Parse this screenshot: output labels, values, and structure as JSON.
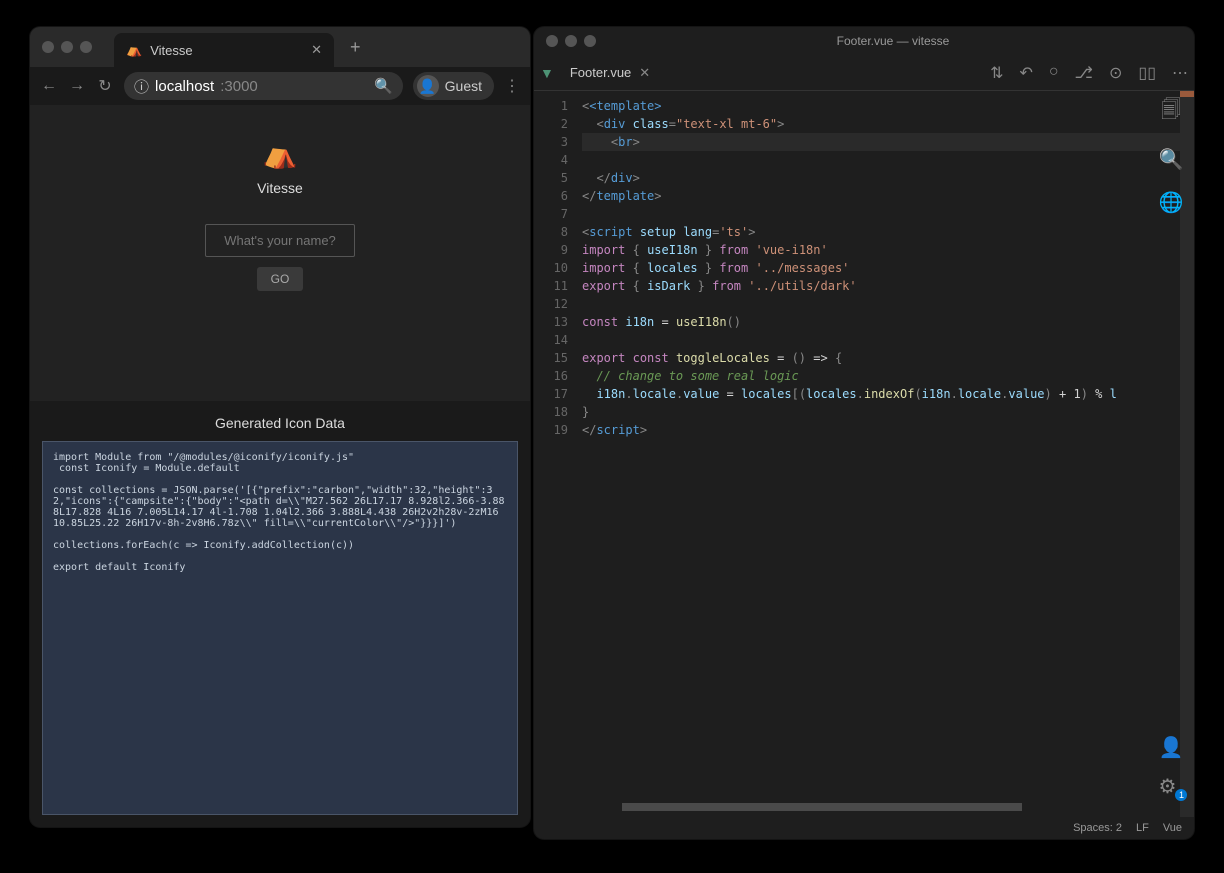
{
  "browser": {
    "tab": {
      "title": "Vitesse"
    },
    "url": {
      "host": "localhost",
      "port": ":3000"
    },
    "profile": "Guest",
    "page": {
      "title": "Vitesse",
      "input_placeholder": "What's your name?",
      "go_label": "GO"
    },
    "generated": {
      "title": "Generated Icon Data",
      "code": "import Module from \"/@modules/@iconify/iconify.js\"\n const Iconify = Module.default\n\nconst collections = JSON.parse('[{\"prefix\":\"carbon\",\"width\":32,\"height\":32,\"icons\":{\"campsite\":{\"body\":\"<path d=\\\\\"M27.562 26L17.17 8.928l2.366-3.888L17.828 4L16 7.005L14.17 4l-1.708 1.04l2.366 3.888L4.438 26H2v2h28v-2zM16 10.85L25.22 26H17v-8h-2v8H6.78z\\\\\" fill=\\\\\"currentColor\\\\\"/>\"}}}]')\n\ncollections.forEach(c => Iconify.addCollection(c))\n\nexport default Iconify"
    }
  },
  "editor": {
    "title": "Footer.vue — vitesse",
    "tab": "Footer.vue",
    "lines": [
      "1",
      "2",
      "3",
      "4",
      "5",
      "6",
      "7",
      "8",
      "9",
      "10",
      "11",
      "12",
      "13",
      "14",
      "15",
      "16",
      "17",
      "18",
      "19"
    ],
    "code": {
      "l1": "<template>",
      "l2a": "<div",
      "l2b": "class",
      "l2c": "\"text-xl mt-6\"",
      "l3": "<br>",
      "l4": "</div>",
      "l5": "</template>",
      "l7a": "<script",
      "l7b": "setup",
      "l7c": "lang",
      "l7d": "'ts'",
      "l8a": "import",
      "l8b": "useI18n",
      "l8c": "from",
      "l8d": "'vue-i18n'",
      "l9a": "import",
      "l9b": "locales",
      "l9c": "from",
      "l9d": "'../messages'",
      "l10a": "export",
      "l10b": "isDark",
      "l10c": "from",
      "l10d": "'../utils/dark'",
      "l12a": "const",
      "l12b": "i18n",
      "l12c": "useI18n",
      "l14a": "export",
      "l14b": "const",
      "l14c": "toggleLocales",
      "l15": "// change to some real logic",
      "l16a": "i18n",
      "l16b": "locale",
      "l16c": "value",
      "l16d": "locales",
      "l16e": "indexOf",
      "l16f": "i18n",
      "l16g": "locale",
      "l16h": "value",
      "l16i": "1",
      "l16j": "l",
      "l18": "</script>"
    },
    "status": {
      "spaces": "Spaces: 2",
      "eol": "LF",
      "lang": "Vue"
    },
    "gear_badge": "1"
  }
}
